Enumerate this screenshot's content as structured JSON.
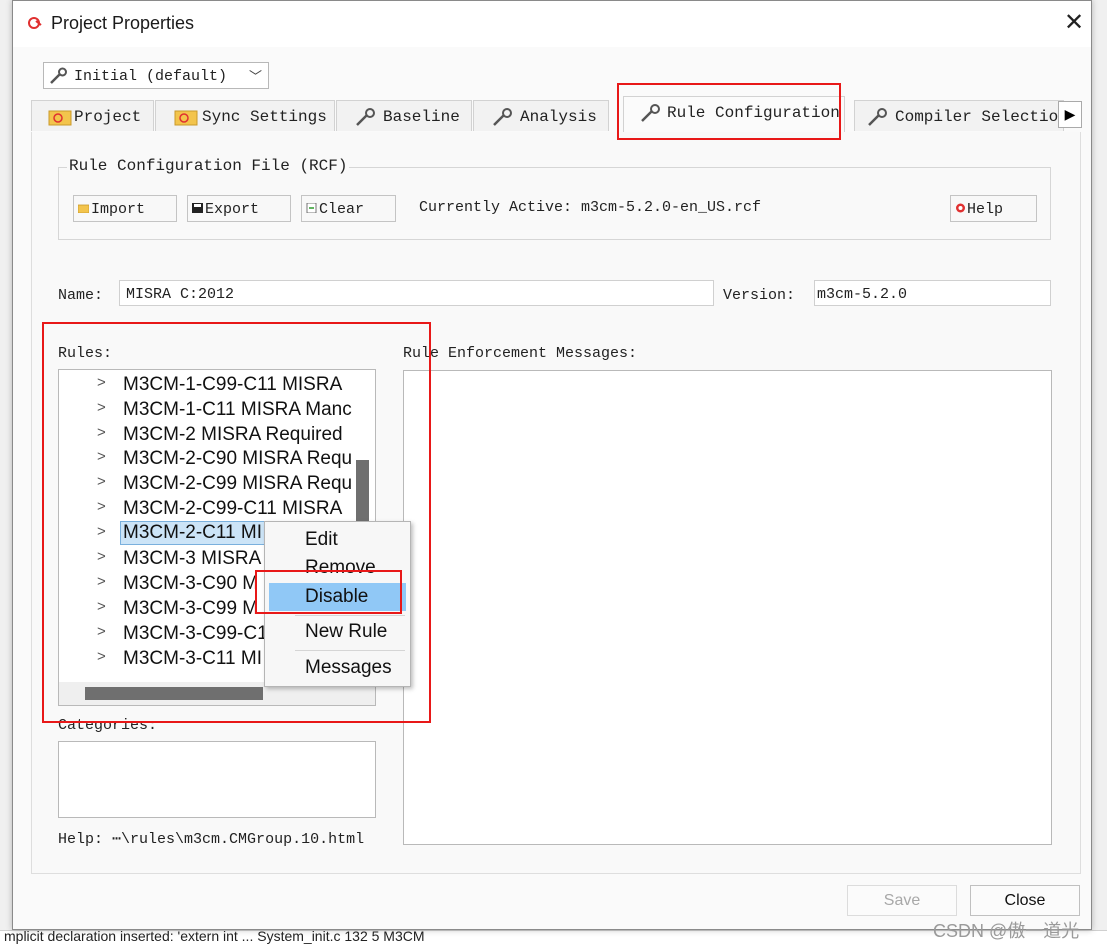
{
  "window": {
    "title": "Project Properties",
    "close_glyph": "✕"
  },
  "profile_select": {
    "value": "Initial (default)",
    "icon": "wrench-icon"
  },
  "tabs": [
    {
      "label": "Project",
      "icon": "project-folder-icon"
    },
    {
      "label": "Sync Settings",
      "icon": "project-folder-icon"
    },
    {
      "label": "Baseline",
      "icon": "wrench-icon"
    },
    {
      "label": "Analysis",
      "icon": "wrench-icon"
    },
    {
      "label": "Rule Configuration",
      "icon": "wrench-icon",
      "active": true
    },
    {
      "label": "Compiler Selection",
      "icon": "wrench-icon"
    }
  ],
  "rcf": {
    "legend": "Rule Configuration File (RCF)",
    "import_label": "Import",
    "export_label": "Export",
    "clear_label": "Clear",
    "active_text": "Currently Active: m3cm-5.2.0-en_US.rcf",
    "help_label": "Help"
  },
  "name_field": {
    "label": "Name:",
    "value": "MISRA C:2012"
  },
  "version_field": {
    "label": "Version:",
    "value": "m3cm-5.2.0"
  },
  "rules": {
    "label": "Rules:",
    "items": [
      "M3CM-1-C99-C11 MISRA",
      "M3CM-1-C11 MISRA Manc",
      "M3CM-2 MISRA Required",
      "M3CM-2-C90 MISRA Requ",
      "M3CM-2-C99 MISRA Requ",
      "M3CM-2-C99-C11 MISRA",
      "M3CM-2-C11 MI",
      "M3CM-3 MISRA",
      "M3CM-3-C90 M",
      "M3CM-3-C99 M",
      "M3CM-3-C99-C1",
      "M3CM-3-C11 MI"
    ],
    "selected_index": 6
  },
  "context_menu": {
    "items": [
      "Edit",
      "Remove",
      "Disable",
      "New Rule",
      "Messages"
    ],
    "highlighted": "Disable"
  },
  "messages_label": "Rule Enforcement Messages:",
  "categories_label": "Categories:",
  "help_path": "Help: ⋯\\rules\\m3cm.CMGroup.10.html",
  "footer": {
    "save_label": "Save",
    "close_label": "Close"
  },
  "background": {
    "status_text": "mplicit declaration inserted: 'extern int ...  System_init.c        132   5        M3CM"
  },
  "watermark": "CSDN @傲一道光",
  "colors": {
    "highlight": "#90c8f6",
    "selection": "#cce4f7",
    "annotation_red": "#e81818"
  }
}
